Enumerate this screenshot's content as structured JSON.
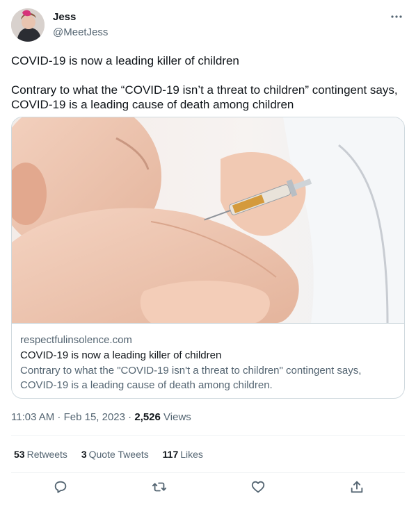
{
  "author": {
    "name": "Jess",
    "handle": "@MeetJess"
  },
  "tweet": {
    "line1": "COVID-19 is now a leading killer of children",
    "line2": "Contrary to what the “COVID-19 isn’t a threat to children” contingent says, COVID-19 is a leading cause of death among children"
  },
  "card": {
    "domain": "respectfulinsolence.com",
    "title": "COVID-19 is now a leading killer of children",
    "description": "Contrary to what the \"COVID-19 isn't a threat to children\" contingent says, COVID-19 is a leading cause of death among children."
  },
  "meta": {
    "time": "11:03 AM · Feb 15, 2023 · ",
    "views_count": "2,526",
    "views_label": " Views"
  },
  "stats": [
    {
      "count": "53",
      "label": "Retweets"
    },
    {
      "count": "3",
      "label": "Quote Tweets"
    },
    {
      "count": "117",
      "label": "Likes"
    }
  ],
  "icons": {
    "more": "more-horizontal-icon",
    "reply": "reply-icon",
    "retweet": "retweet-icon",
    "like": "heart-icon",
    "share": "share-icon"
  }
}
